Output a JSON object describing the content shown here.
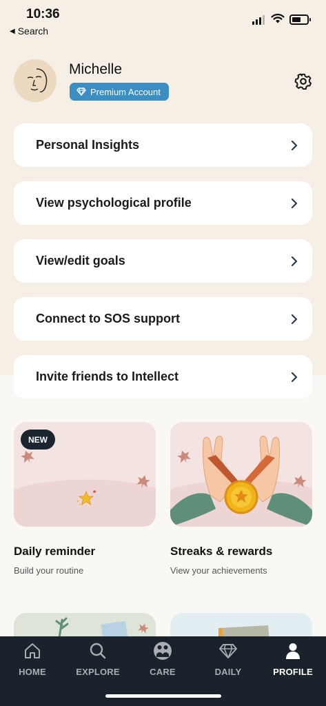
{
  "status_bar": {
    "time": "10:36",
    "back_label": "Search"
  },
  "profile": {
    "name": "Michelle",
    "badge": "Premium Account"
  },
  "menu": [
    {
      "label": "Personal Insights"
    },
    {
      "label": "View psychological profile"
    },
    {
      "label": "View/edit goals"
    },
    {
      "label": "Connect to SOS support"
    },
    {
      "label": "Invite friends to Intellect"
    }
  ],
  "features": [
    {
      "badge": "NEW",
      "title": "Daily reminder",
      "subtitle": "Build your routine"
    },
    {
      "title": "Streaks & rewards",
      "subtitle": "View your achievements"
    }
  ],
  "tabs": [
    {
      "label": "HOME",
      "icon": "home-icon"
    },
    {
      "label": "EXPLORE",
      "icon": "search-icon"
    },
    {
      "label": "CARE",
      "icon": "care-icon"
    },
    {
      "label": "DAILY",
      "icon": "diamond-icon"
    },
    {
      "label": "PROFILE",
      "icon": "person-icon",
      "active": true
    }
  ],
  "colors": {
    "accent": "#3b8ec2",
    "background": "#f6efe5",
    "tabbar": "#1a232c"
  }
}
